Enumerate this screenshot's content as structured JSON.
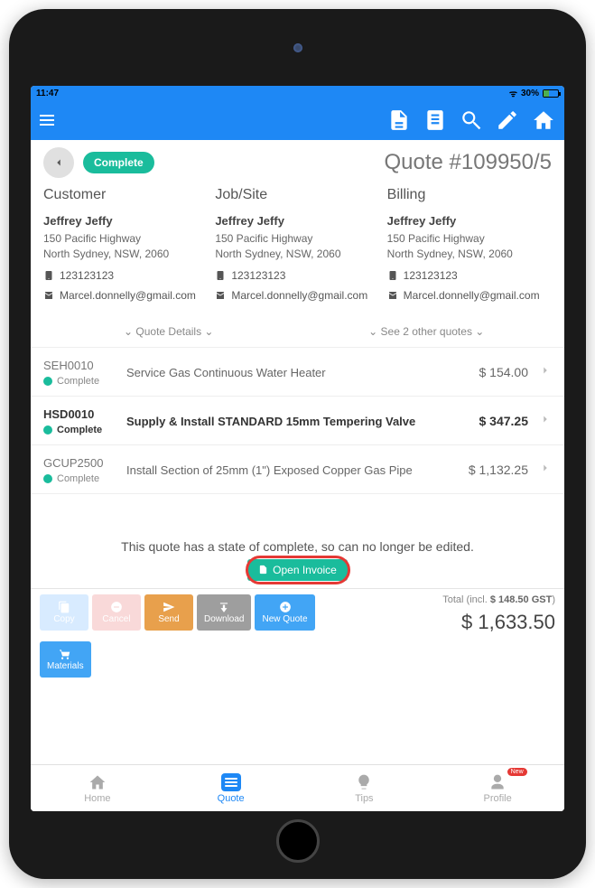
{
  "status": {
    "time": "11:47",
    "battery": "30%"
  },
  "appbar_icons": [
    "document",
    "book",
    "search",
    "edit",
    "home"
  ],
  "header": {
    "status_pill": "Complete",
    "title": "Quote #109950/5"
  },
  "sections": {
    "customer": {
      "heading": "Customer",
      "name": "Jeffrey Jeffy",
      "addr1": "150 Pacific Highway",
      "addr2": "North Sydney, NSW, 2060",
      "phone": "123123123",
      "email": "Marcel.donnelly@gmail.com"
    },
    "jobsite": {
      "heading": "Job/Site",
      "name": "Jeffrey Jeffy",
      "addr1": "150 Pacific Highway",
      "addr2": "North Sydney, NSW, 2060",
      "phone": "123123123",
      "email": "Marcel.donnelly@gmail.com"
    },
    "billing": {
      "heading": "Billing",
      "name": "Jeffrey Jeffy",
      "addr1": "150 Pacific Highway",
      "addr2": "North Sydney, NSW, 2060",
      "phone": "123123123",
      "email": "Marcel.donnelly@gmail.com"
    }
  },
  "expanders": {
    "details": "Quote Details",
    "others": "See 2 other quotes"
  },
  "lines": [
    {
      "code": "SEH0010",
      "status": "Complete",
      "desc": "Service Gas Continuous Water Heater",
      "price": "$ 154.00",
      "active": false
    },
    {
      "code": "HSD0010",
      "status": "Complete",
      "desc": "Supply & Install STANDARD 15mm Tempering Valve",
      "price": "$ 347.25",
      "active": true
    },
    {
      "code": "GCUP2500",
      "status": "Complete",
      "desc": "Install Section of 25mm (1\") Exposed Copper Gas Pipe",
      "price": "$ 1,132.25",
      "active": false
    }
  ],
  "foot_msg": "This quote has a state of complete, so can no longer be edited.",
  "open_invoice_label": "Open Invoice",
  "actions": {
    "copy": "Copy",
    "cancel": "Cancel",
    "send": "Send",
    "download": "Download",
    "newquote": "New Quote",
    "materials": "Materials"
  },
  "totals": {
    "label_prefix": "Total (incl. ",
    "gst": "$ 148.50 GST",
    "label_suffix": ")",
    "grand": "$ 1,633.50"
  },
  "tabs": {
    "home": "Home",
    "quote": "Quote",
    "tips": "Tips",
    "profile": "Profile",
    "badge": "New"
  }
}
